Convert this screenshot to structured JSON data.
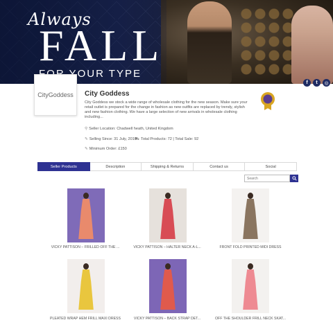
{
  "banner": {
    "script_text": "Always",
    "headline": "FALL",
    "tagline": "FOR YOUR TYPE"
  },
  "social": [
    {
      "name": "facebook",
      "glyph": "f"
    },
    {
      "name": "twitter",
      "glyph": "t"
    },
    {
      "name": "instagram",
      "glyph": "◎"
    }
  ],
  "store": {
    "logo_text": "CityGoddess",
    "name": "City Goddess",
    "description": "City Goddess we stock a wide range of wholesale clothing for the new season. Make sure your retail outlet is prepared for the change in fashion as new outfits are replaced by trendy, stylish and new fashion clothing. We have a large selection of new arrivals in wholesale clothing including...",
    "location": "Seller Location: Chadwell heath, United Kingdom",
    "selling_since": "Selling Since: 31 July, 2019",
    "total_products": "Total Products: 72 | Total Sale: 92",
    "minimum_order": "Minimum Order: £150"
  },
  "tabs": [
    {
      "label": "Seller Products",
      "active": true
    },
    {
      "label": "Description",
      "active": false
    },
    {
      "label": "Shipping & Returns",
      "active": false
    },
    {
      "label": "Contact us",
      "active": false
    },
    {
      "label": "Social",
      "active": false
    }
  ],
  "search": {
    "placeholder": "Search"
  },
  "colors": {
    "accent": "#2e3292",
    "badge_gold": "#d9a521",
    "badge_purple": "#5a3d8f"
  },
  "products": [
    {
      "caption": "VICKY PATTISON – FRILLED OFF THE ...",
      "bg": "#7f6bb8",
      "dress": "#e98a6c"
    },
    {
      "caption": "VICKY PATTISON – HALTER NECK A-L...",
      "bg": "#e6e1dc",
      "dress": "#d84c55"
    },
    {
      "caption": "FRONT FOLD PRINTED MIDI DRESS",
      "bg": "#f4f2f0",
      "dress": "#8a7560"
    },
    {
      "caption": "PLEATED WRAP HEM FRILL MAXI DRESS",
      "bg": "#f2eeec",
      "dress": "#e9c63e"
    },
    {
      "caption": "VICKY PATTISON – BACK STRAP DET...",
      "bg": "#7d66b6",
      "dress": "#e05a4c"
    },
    {
      "caption": "OFF THE SHOULDER FRILL NECK SKAT...",
      "bg": "#f3f1ef",
      "dress": "#ee8a92"
    }
  ]
}
